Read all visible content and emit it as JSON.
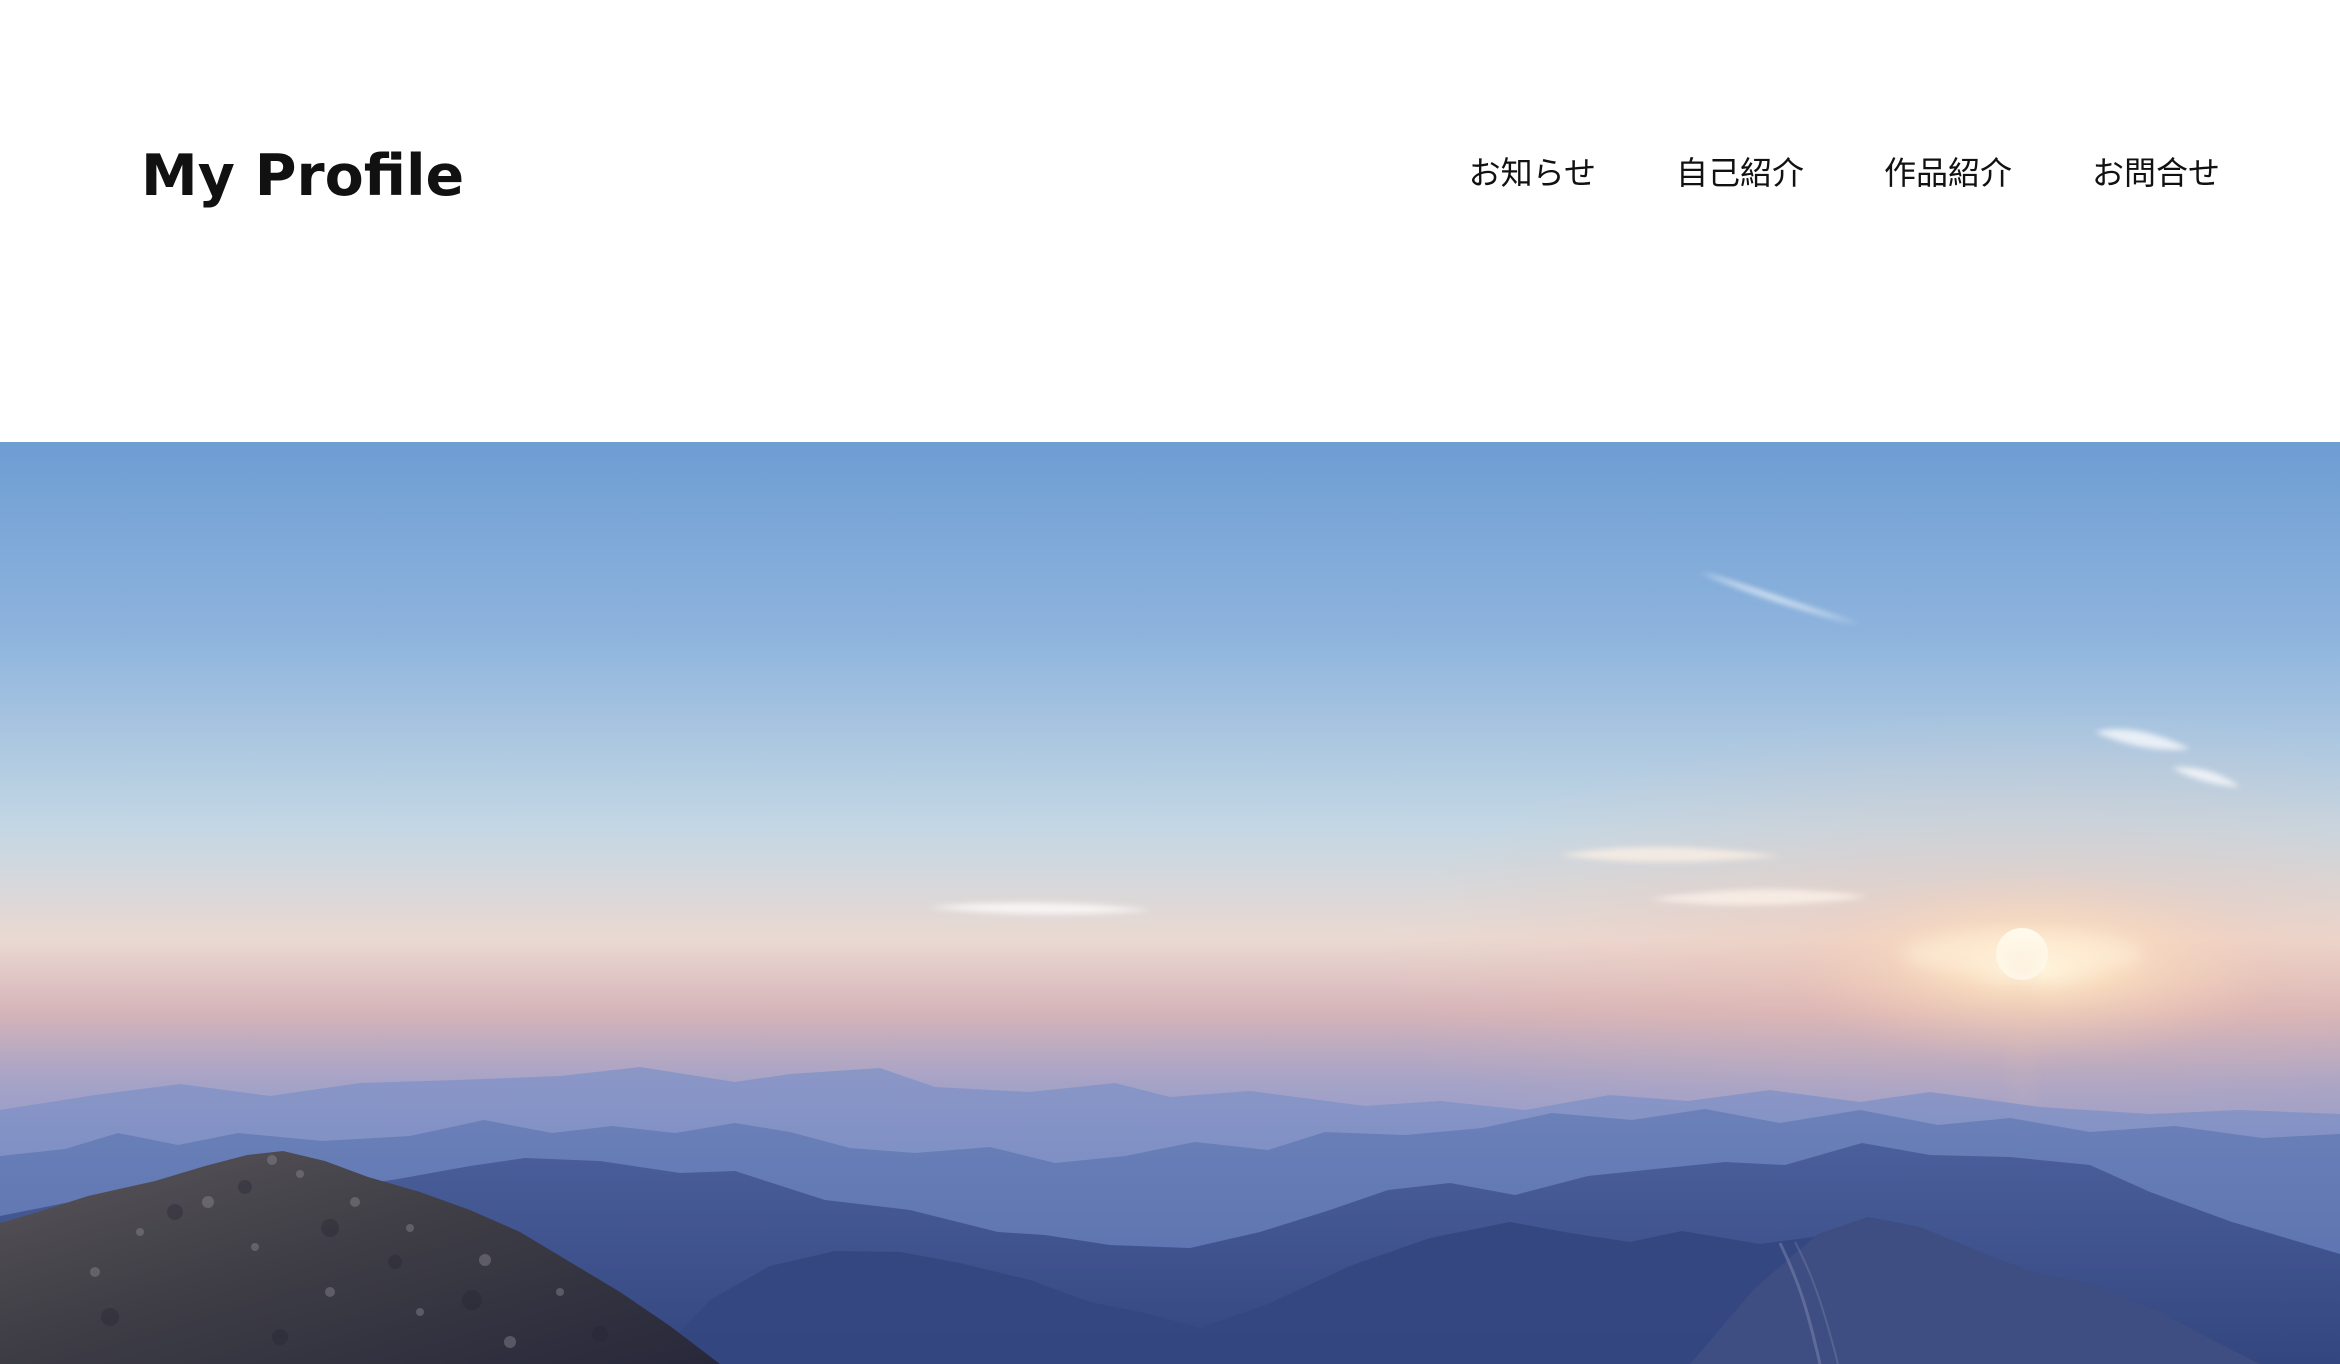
{
  "header": {
    "site_title": "My Profile",
    "nav": [
      {
        "label": "お知らせ"
      },
      {
        "label": "自己紹介"
      },
      {
        "label": "作品紹介"
      },
      {
        "label": "お問合せ"
      }
    ]
  },
  "hero": {
    "image": "mountain-sunrise-landscape"
  },
  "colors": {
    "background": "#ffffff",
    "text": "#111111",
    "sky_top": "#6f9ed4",
    "horizon_glow": "#f2d4c3",
    "sun": "#fff9e8",
    "mountain_far": "#7287c3",
    "mountain_near": "#3e4f89",
    "rock": "#3e3d45"
  }
}
